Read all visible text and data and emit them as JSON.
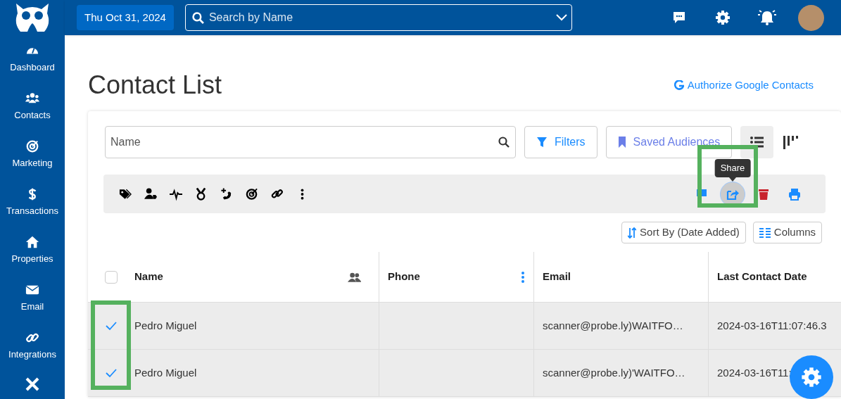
{
  "topbar": {
    "date": "Thu Oct 31, 2024",
    "search_placeholder": "Search by Name"
  },
  "sidebar": {
    "items": [
      {
        "label": "Dashboard"
      },
      {
        "label": "Contacts"
      },
      {
        "label": "Marketing"
      },
      {
        "label": "Transactions"
      },
      {
        "label": "Properties"
      },
      {
        "label": "Email"
      },
      {
        "label": "Integrations"
      }
    ]
  },
  "page": {
    "title": "Contact List",
    "google_link": "Authorize Google Contacts"
  },
  "filters": {
    "name_placeholder": "Name",
    "filters_button": "Filters",
    "audiences_button": "Saved Audiences",
    "views": [
      {
        "selected": true
      },
      {
        "selected": false
      }
    ]
  },
  "toolbar": {
    "right_actions": [
      {
        "hovered": false
      },
      {
        "hovered": true,
        "tooltip": "Share"
      },
      {
        "hovered": false
      },
      {
        "hovered": false
      }
    ]
  },
  "sort_button": "Sort By (Date Added)",
  "columns_button": "Columns",
  "table": {
    "header_checked": false,
    "columns": [
      "Name",
      "Phone",
      "Email",
      "Last Contact Date"
    ],
    "rows": [
      {
        "checked": true,
        "cells": [
          "Pedro Miguel",
          "",
          "scanner@probe.ly)WAITFO…",
          "2024-03-16T11:07:46.3"
        ]
      },
      {
        "checked": true,
        "cells": [
          "Pedro Miguel",
          "",
          "scanner@probe.ly)'WAITFO…",
          "2024-03-16T11:"
        ]
      }
    ]
  }
}
